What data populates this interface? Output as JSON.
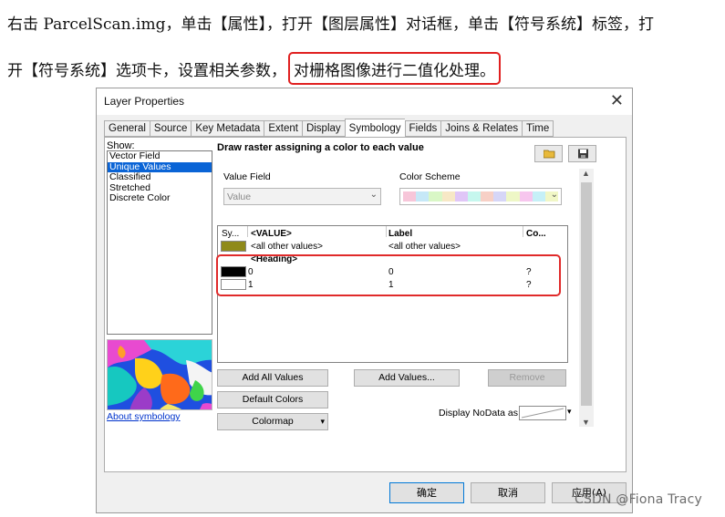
{
  "document": {
    "line1": "右击 ParcelScan.img，单击【属性】，打开【图层属性】对话框，单击【符号系统】标签，打",
    "line2_before": "开【符号系统】选项卡，设置相关参数，",
    "line2_highlight": "对栅格图像进行二值化处理。"
  },
  "dialog": {
    "title": "Layer Properties",
    "close": "✕",
    "tabs": [
      "General",
      "Source",
      "Key Metadata",
      "Extent",
      "Display",
      "Symbology",
      "Fields",
      "Joins & Relates",
      "Time"
    ],
    "active_tab": "Symbology",
    "show_label": "Show:",
    "show_items": [
      "Vector Field",
      "Unique Values",
      "Classified",
      "Stretched",
      "Discrete Color"
    ],
    "selected_show": "Unique Values",
    "about_link": "About symbology",
    "heading": "Draw raster assigning a color to each value",
    "value_field_label": "Value Field",
    "value_field_value": "Value",
    "color_scheme_label": "Color Scheme",
    "color_scheme_colors": [
      "#f7c6d9",
      "#c6e8f7",
      "#d9f7c6",
      "#f7e8c6",
      "#e0c6f7",
      "#c6f7ee",
      "#f7d0c6",
      "#d6d6f7",
      "#eef7c6",
      "#f7c6ee",
      "#c6f0f7",
      "#f1f7c6"
    ],
    "grid": {
      "headers": [
        "Sy...",
        "<VALUE>",
        "Label",
        "Co..."
      ],
      "other_row": {
        "value": "<all other values>",
        "label": "<all other values>",
        "swatch": "#8f8a1a"
      },
      "heading_row": "<Heading>",
      "rows": [
        {
          "value": "0",
          "label": "0",
          "count": "?",
          "swatch": "#000000"
        },
        {
          "value": "1",
          "label": "1",
          "count": "?",
          "swatch": "#ffffff"
        }
      ]
    },
    "buttons": {
      "add_all": "Add All Values",
      "add_values": "Add Values...",
      "remove": "Remove",
      "default_colors": "Default Colors",
      "colormap": "Colormap"
    },
    "nodata_label": "Display NoData as",
    "footer": {
      "ok": "确定",
      "cancel": "取消",
      "apply": "应用(A)"
    }
  },
  "watermark": "CSDN @Fiona Tracy"
}
